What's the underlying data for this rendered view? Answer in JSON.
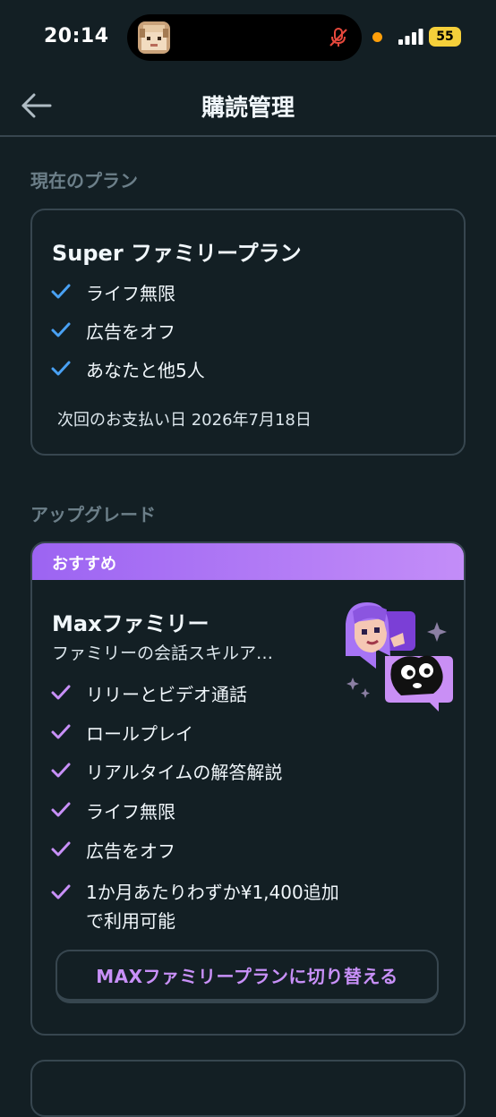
{
  "status_bar": {
    "time": "20:14",
    "battery": "55"
  },
  "header": {
    "title": "購読管理"
  },
  "current_plan": {
    "section_label": "現在のプラン",
    "title": "Super ファミリープラン",
    "features": [
      "ライフ無限",
      "広告をオフ",
      "あなたと他5人"
    ],
    "next_payment": "次回のお支払い日 2026年7月18日"
  },
  "upgrade": {
    "section_label": "アップグレード",
    "badge": "おすすめ",
    "title": "Maxファミリー",
    "subtitle": "ファミリーの会話スキルア…",
    "features": [
      "リリーとビデオ通話",
      "ロールプレイ",
      "リアルタイムの解答解説",
      "ライフ無限",
      "広告をオフ"
    ],
    "price_note": "1か月あたりわずか¥1,400追加で利用可能",
    "button_label": "MAXファミリープランに切り替える"
  },
  "colors": {
    "background": "#131f24",
    "border": "#37464f",
    "check_blue": "#49a1f4",
    "check_purple": "#c890f8",
    "accent_purple": "#9c64f2"
  },
  "icons": {
    "back": "arrow-left-icon",
    "check": "checkmark-icon",
    "mic_muted": "mic-off-icon",
    "signal": "cellular-signal-icon"
  }
}
